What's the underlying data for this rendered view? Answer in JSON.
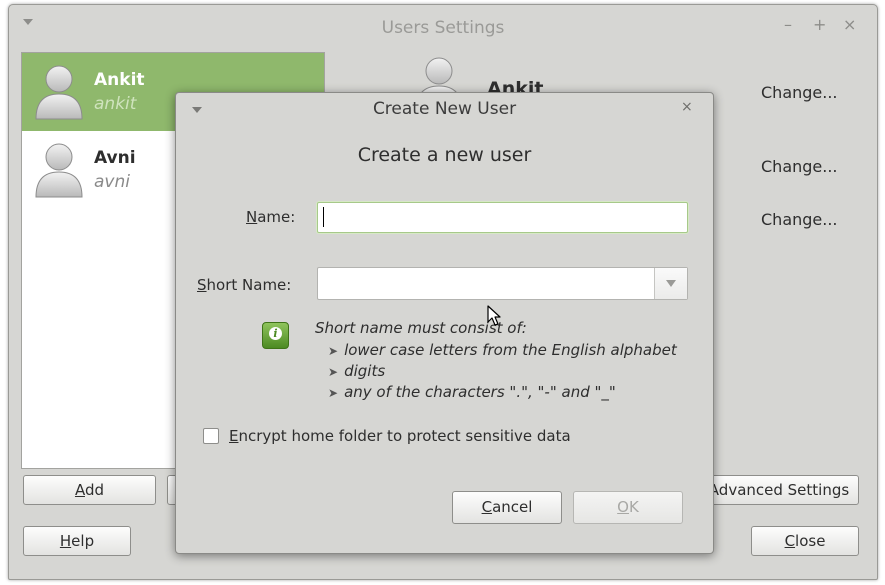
{
  "main_window": {
    "title": "Users Settings",
    "buttons": {
      "minimize": "–",
      "maximize": "+",
      "close": "×"
    },
    "users": [
      {
        "name": "Ankit",
        "login": "ankit",
        "selected": true
      },
      {
        "name": "Avni",
        "login": "avni",
        "selected": false
      }
    ],
    "detail": {
      "name": "Ankit",
      "change_links": [
        "Change...",
        "Change...",
        "Change..."
      ]
    },
    "add_button": {
      "pre": "",
      "mnemonic": "A",
      "post": "dd"
    },
    "advanced_settings_label": "Advanced Settings",
    "help_button": {
      "pre": "",
      "mnemonic": "H",
      "post": "elp"
    },
    "close_button": {
      "pre": "",
      "mnemonic": "C",
      "post": "lose"
    }
  },
  "dialog": {
    "title": "Create New User",
    "close_glyph": "×",
    "heading": "Create a new user",
    "name_label": {
      "pre": "",
      "mnemonic": "N",
      "post": "ame:"
    },
    "name_value": "",
    "short_name_label": {
      "pre": "",
      "mnemonic": "S",
      "post": "hort Name:"
    },
    "short_name_value": "",
    "hint_title": "Short name must consist of:",
    "hint_items": [
      "lower case letters from the English alphabet",
      "digits",
      "any of the characters \".\", \"-\" and \"_\""
    ],
    "hint_arrow": "➤",
    "encrypt_label": {
      "pre": "",
      "mnemonic": "E",
      "post": "ncrypt home folder to protect sensitive data"
    },
    "encrypt_checked": false,
    "cancel_button": {
      "pre": "",
      "mnemonic": "C",
      "post": "ancel"
    },
    "ok_button": {
      "pre": "",
      "mnemonic": "O",
      "post": "K",
      "enabled": false
    },
    "info_glyph": "i"
  },
  "colors": {
    "selection": "#8fb86c",
    "window_bg": "#d6d6d3",
    "focus_border": "#a7c98a"
  },
  "icons": [
    "menu-arrow-icon",
    "user-avatar-icon",
    "info-icon",
    "dropdown-arrow-icon",
    "mouse-pointer-icon"
  ]
}
